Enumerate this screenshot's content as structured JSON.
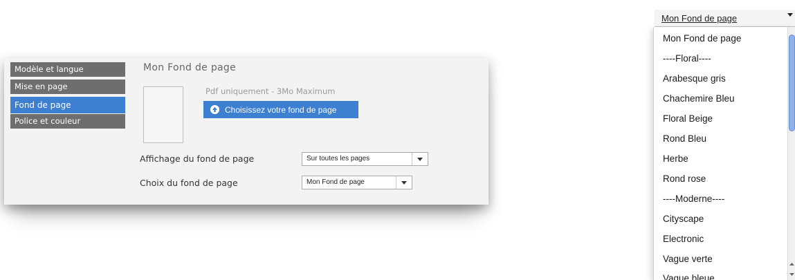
{
  "sidebar": {
    "items": [
      {
        "label": "Modèle et langue"
      },
      {
        "label": "Mise en page"
      },
      {
        "label": "Fond de page",
        "active": true
      },
      {
        "label": "Police et couleur"
      }
    ]
  },
  "main": {
    "title": "Mon Fond de page",
    "upload_hint": "Pdf uniquement - 3Mo Maximum",
    "upload_button": "Choisissez votre fond de page",
    "display_label": "Affichage du fond de page",
    "display_value": "Sur toutes les pages",
    "choice_label": "Choix du fond de page",
    "choice_value": "Mon Fond de page"
  },
  "dropdown": {
    "selected": "Mon Fond de page",
    "options": [
      "Mon Fond de page",
      "----Floral----",
      "Arabesque gris",
      "Chachemire Bleu",
      "Floral Beige",
      "Rond Bleu",
      "Herbe",
      "Rond rose",
      "----Moderne----",
      "Cityscape",
      "Electronic",
      "Vague verte",
      "Vague bleue"
    ]
  },
  "colors": {
    "accent": "#3d7fd0",
    "sidebar_bg": "#6e6e6e",
    "panel_bg": "#f3f3f3"
  },
  "icons": {
    "upload": "arrow-up-circle-icon",
    "dropdown": "chevron-down-icon"
  }
}
